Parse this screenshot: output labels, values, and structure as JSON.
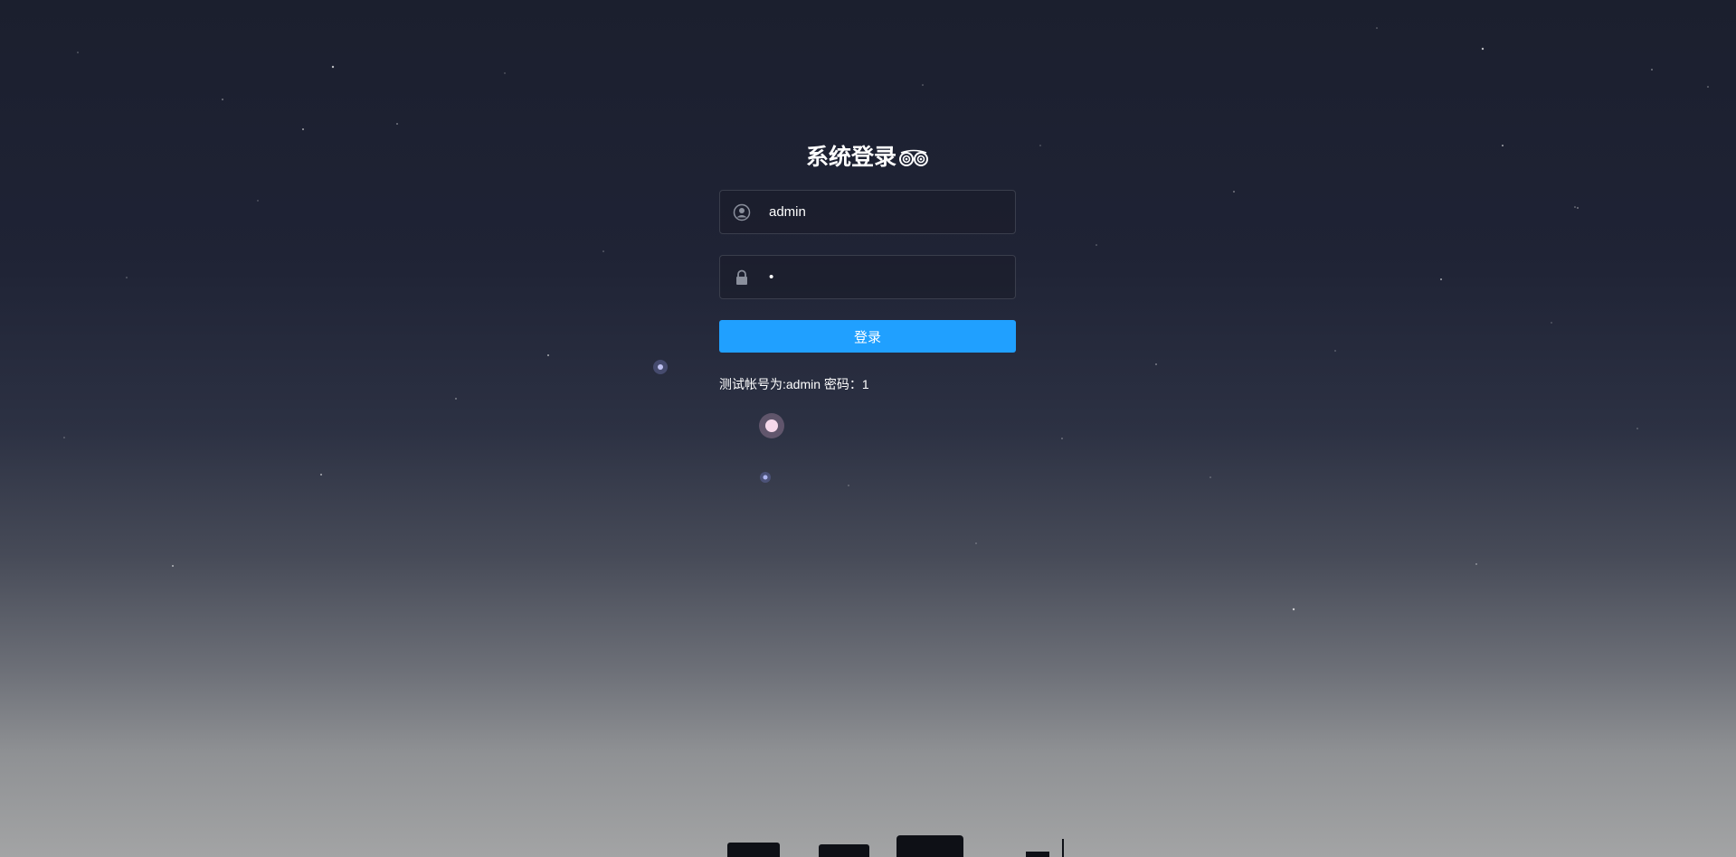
{
  "login": {
    "title": "系统登录",
    "username_value": "admin",
    "password_value": "1",
    "button_label": "登录",
    "tips": "测试帐号为:admin 密码：1"
  },
  "icons": {
    "title": "owl-eyes-icon",
    "username": "user-circle-icon",
    "password": "lock-icon"
  },
  "colors": {
    "button": "#20a0ff",
    "text": "#ffffff"
  }
}
